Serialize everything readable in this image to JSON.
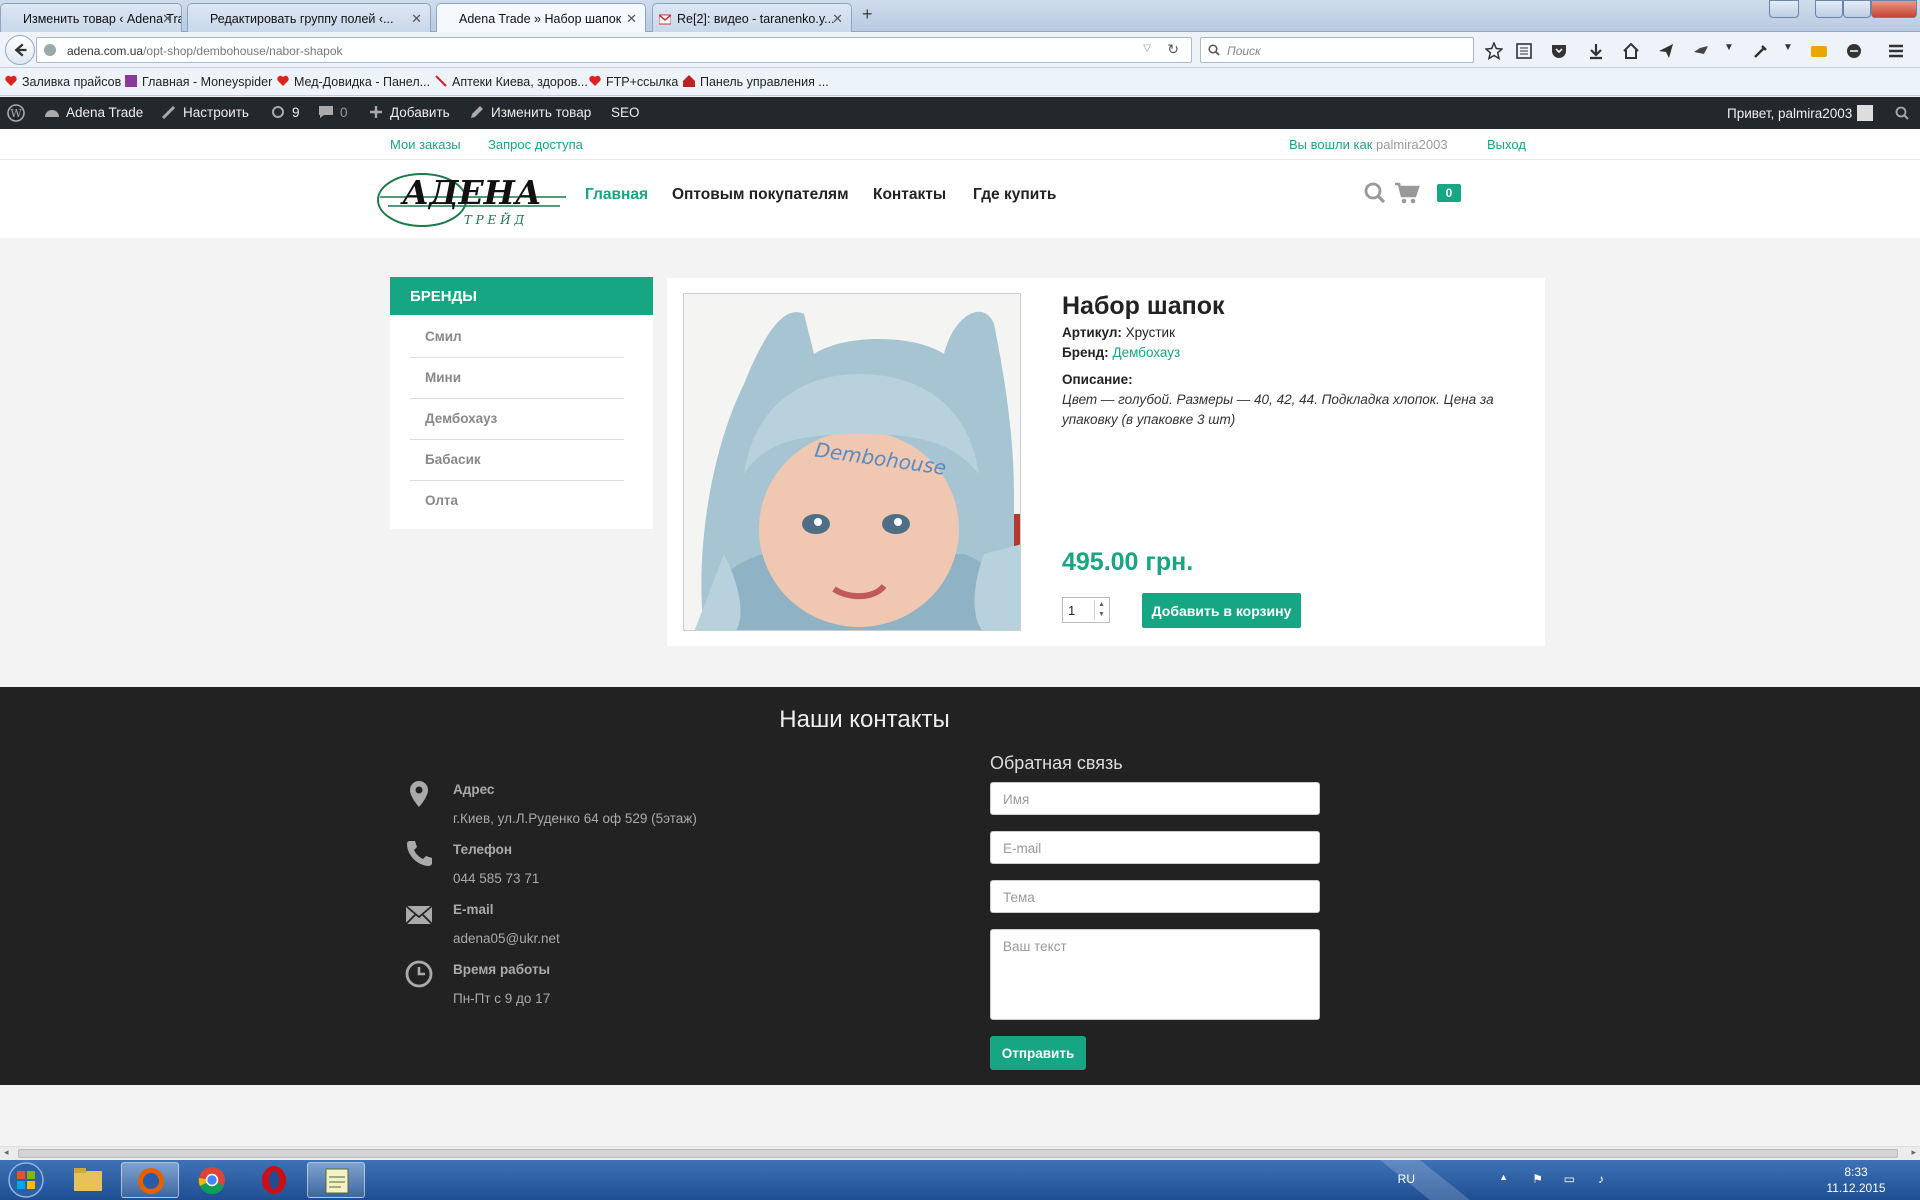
{
  "browser": {
    "tabs": [
      {
        "label": "Изменить товар ‹ Adena Trade..."
      },
      {
        "label": "Редактировать группу полей ‹..."
      },
      {
        "label": "Adena Trade » Набор шапок"
      },
      {
        "label": "Re[2]: видео - taranenko.y..."
      }
    ],
    "new_tab": "+",
    "url_domain": "adena.com.ua",
    "url_path": "/opt-shop/dembohouse/nabor-shapok",
    "search_placeholder": "Поиск",
    "bookmarks": [
      {
        "label": "Заливка прайсов"
      },
      {
        "label": "Главная - Moneyspider"
      },
      {
        "label": "Мед-Довидка - Панел..."
      },
      {
        "label": "Аптеки Киева, здоров..."
      },
      {
        "label": "FTP+ссылка"
      },
      {
        "label": "Панель управления ..."
      }
    ]
  },
  "adminbar": {
    "site": "Adena Trade",
    "customize": "Настроить",
    "updates": "9",
    "comments": "0",
    "add": "Добавить",
    "edit": "Изменить товар",
    "seo": "SEO",
    "greeting": "Привет, palmira2003"
  },
  "toplinks": {
    "orders": "Мои заказы",
    "access": "Запрос доступа",
    "logged_in": "Вы вошли как",
    "username": "palmira2003",
    "logout": "Выход"
  },
  "header": {
    "logo_main": "АДЕНА",
    "logo_sub": "Т Р Е Й Д",
    "nav": [
      "Главная",
      "Оптовым покупателям",
      "Контакты",
      "Где купить"
    ],
    "cart_count": "0"
  },
  "sidebar": {
    "title": "БРЕНДЫ",
    "items": [
      "Смил",
      "Мини",
      "Дембохауз",
      "Бабасик",
      "Олта"
    ]
  },
  "product": {
    "title": "Набор шапок",
    "sku_label": "Артикул:",
    "sku": "Хрустик",
    "brand_label": "Бренд:",
    "brand": "Дембохауз",
    "desc_label": "Описание:",
    "description": "Цвет — голубой. Размеры — 40, 42, 44. Подкладка хлопок. Цена за упаковку (в упаковке 3 шт)",
    "price": "495.00 грн.",
    "qty": "1",
    "add_to_cart": "Добавить в корзину",
    "hat_text": "Dembohouse"
  },
  "footer": {
    "title": "Наши контакты",
    "contacts": [
      {
        "label": "Адрес",
        "value": "г.Киев, ул.Л.Руденко 64 оф 529 (5этаж)",
        "icon": "location-pin-icon"
      },
      {
        "label": "Телефон",
        "value": "044 585 73 71",
        "icon": "phone-icon"
      },
      {
        "label": "E-mail",
        "value": "adena05@ukr.net",
        "icon": "envelope-icon"
      },
      {
        "label": "Время работы",
        "value": "Пн-Пт с 9 до 17",
        "icon": "clock-icon"
      }
    ],
    "feedback_title": "Обратная связь",
    "name_placeholder": "Имя",
    "email_placeholder": "E-mail",
    "subject_placeholder": "Тема",
    "message_placeholder": "Ваш текст",
    "send": "Отправить"
  },
  "taskbar": {
    "lang": "RU",
    "time": "8:33",
    "date": "11.12.2015"
  },
  "colors": {
    "accent": "#17a684",
    "adminbar": "#23282d",
    "footer": "#222222"
  }
}
